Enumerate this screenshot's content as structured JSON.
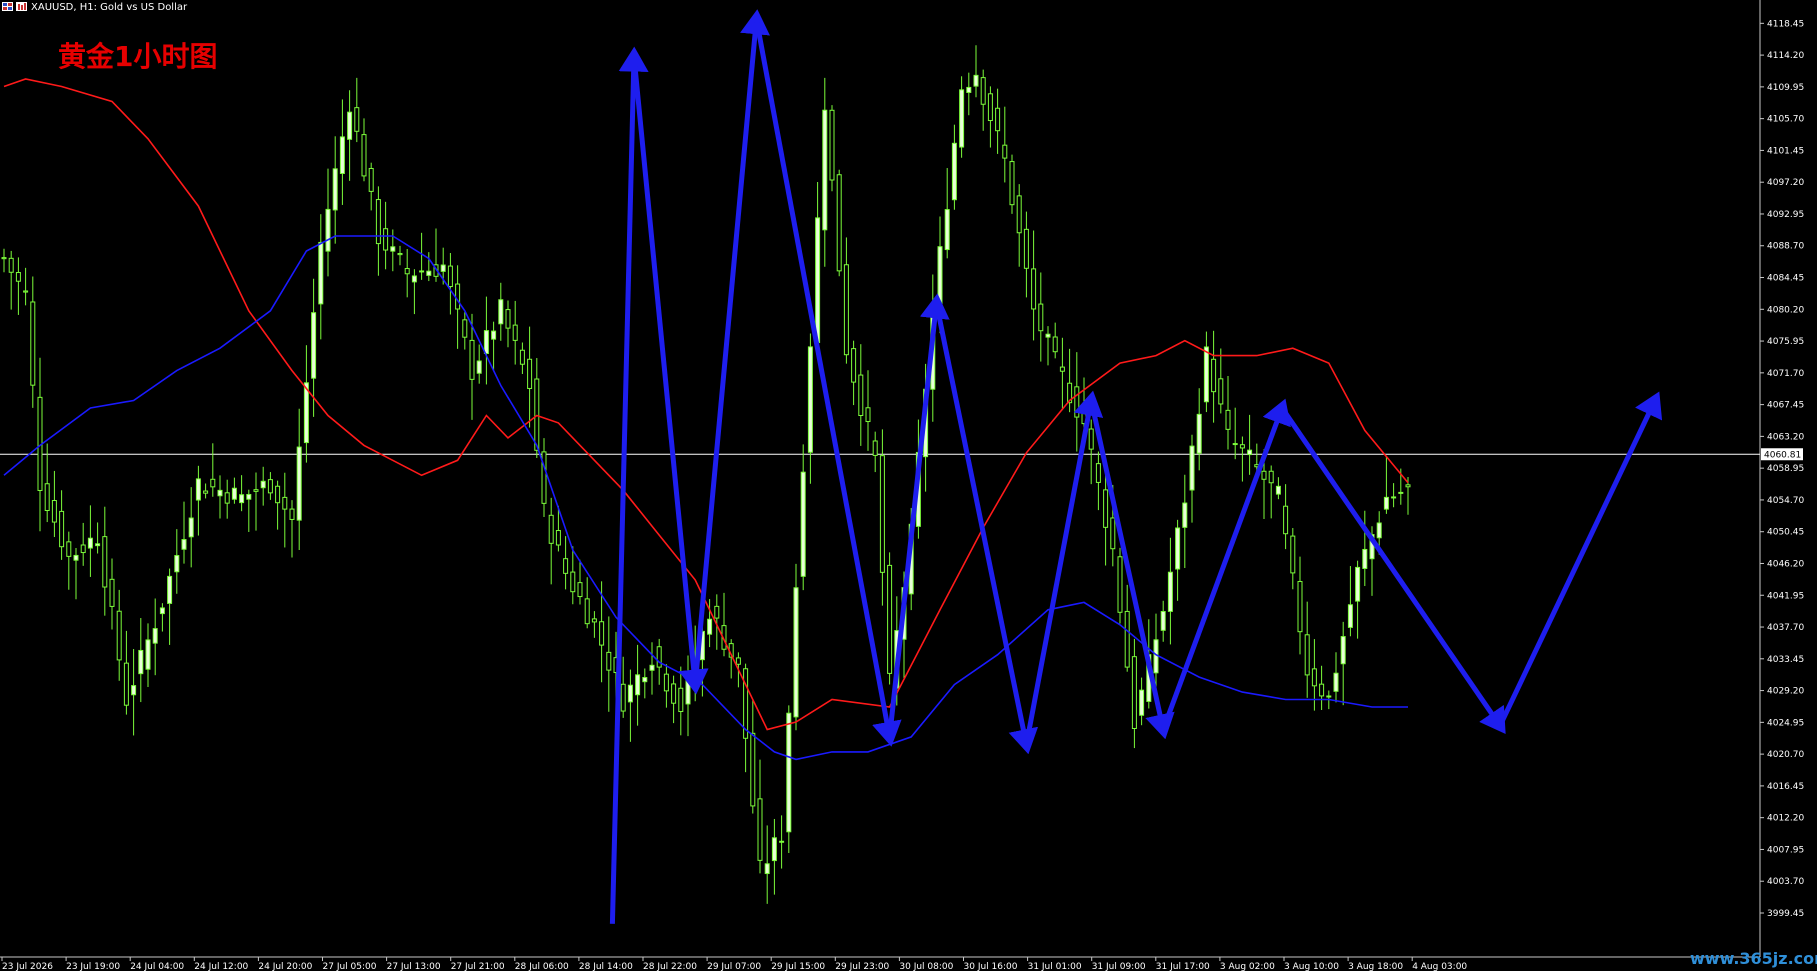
{
  "window": {
    "symbol_title": "XAUUSD, H1:  Gold vs US Dollar",
    "annotation_title": "黄金1小时图",
    "watermark": "www.365jz.com"
  },
  "colors": {
    "background": "#000000",
    "candle": "#7cfc3a",
    "candle_body": "#e8ffd8",
    "ma_fast": "#ff1a1a",
    "ma_slow": "#1a1aff",
    "arrows": "#1e1eee",
    "current_price_line": "#ffffff"
  },
  "icons": [
    "chart-window-icon",
    "chart-type-icon"
  ],
  "chart_data": {
    "type": "line",
    "ylim": [
      3994.5,
      4120.5
    ],
    "y_ticks": [
      "4118.45",
      "4114.20",
      "4109.95",
      "4105.70",
      "4101.45",
      "4097.20",
      "4092.95",
      "4088.70",
      "4084.45",
      "4080.20",
      "4075.95",
      "4071.70",
      "4067.45",
      "4063.20",
      "4058.95",
      "4054.70",
      "4050.45",
      "4046.20",
      "4041.95",
      "4037.70",
      "4033.45",
      "4029.20",
      "4024.95",
      "4020.70",
      "4016.45",
      "4012.20",
      "4007.95",
      "4003.70",
      "3999.45"
    ],
    "y_tick_values": [
      4118.45,
      4114.2,
      4109.95,
      4105.7,
      4101.45,
      4097.2,
      4092.95,
      4088.7,
      4084.45,
      4080.2,
      4075.95,
      4071.7,
      4067.45,
      4063.2,
      4058.95,
      4054.7,
      4050.45,
      4046.2,
      4041.95,
      4037.7,
      4033.45,
      4029.2,
      4024.95,
      4020.7,
      4016.45,
      4012.2,
      4007.95,
      4003.7,
      3999.45
    ],
    "x_ticks": [
      "23 Jul 2026",
      "23 Jul 19:00",
      "24 Jul 04:00",
      "24 Jul 12:00",
      "24 Jul 20:00",
      "27 Jul 05:00",
      "27 Jul 13:00",
      "27 Jul 21:00",
      "28 Jul 06:00",
      "28 Jul 14:00",
      "28 Jul 22:00",
      "29 Jul 07:00",
      "29 Jul 15:00",
      "29 Jul 23:00",
      "30 Jul 08:00",
      "30 Jul 16:00",
      "31 Jul 01:00",
      "31 Jul 09:00",
      "31 Jul 17:00",
      "3 Aug 02:00",
      "3 Aug 10:00",
      "3 Aug 18:00",
      "4 Aug 03:00"
    ],
    "current_price": 4060.81,
    "current_price_label": "4060.81",
    "anchors": [
      [
        0,
        4087
      ],
      [
        3,
        4082
      ],
      [
        5,
        4057
      ],
      [
        9,
        4047
      ],
      [
        13,
        4050
      ],
      [
        17,
        4028
      ],
      [
        22,
        4041
      ],
      [
        27,
        4057
      ],
      [
        33,
        4055
      ],
      [
        37,
        4057
      ],
      [
        40,
        4052
      ],
      [
        44,
        4089
      ],
      [
        48,
        4108
      ],
      [
        52,
        4090
      ],
      [
        56,
        4085
      ],
      [
        61,
        4086
      ],
      [
        65,
        4072
      ],
      [
        69,
        4080
      ],
      [
        73,
        4070
      ],
      [
        75,
        4053
      ],
      [
        78,
        4045
      ],
      [
        82,
        4038
      ],
      [
        86,
        4028
      ],
      [
        90,
        4034
      ],
      [
        94,
        4027
      ],
      [
        98,
        4040
      ],
      [
        102,
        4032
      ],
      [
        105,
        4005
      ],
      [
        108,
        4010
      ],
      [
        111,
        4060
      ],
      [
        114,
        4108
      ],
      [
        117,
        4075
      ],
      [
        121,
        4060
      ],
      [
        123,
        4030
      ],
      [
        126,
        4050
      ],
      [
        129,
        4080
      ],
      [
        133,
        4110
      ],
      [
        135,
        4112
      ],
      [
        139,
        4100
      ],
      [
        143,
        4080
      ],
      [
        146,
        4073
      ],
      [
        150,
        4065
      ],
      [
        154,
        4048
      ],
      [
        157,
        4025
      ],
      [
        161,
        4040
      ],
      [
        164,
        4055
      ],
      [
        167,
        4074
      ],
      [
        170,
        4063
      ],
      [
        173,
        4060
      ],
      [
        177,
        4055
      ],
      [
        181,
        4032
      ],
      [
        184,
        4028
      ],
      [
        188,
        4045
      ],
      [
        192,
        4055
      ],
      [
        195,
        4056
      ]
    ],
    "ma_fast": [
      [
        0,
        4110
      ],
      [
        3,
        4111
      ],
      [
        8,
        4110
      ],
      [
        15,
        4108
      ],
      [
        20,
        4103
      ],
      [
        27,
        4094
      ],
      [
        34,
        4080
      ],
      [
        40,
        4072
      ],
      [
        45,
        4066
      ],
      [
        50,
        4062
      ],
      [
        58,
        4058
      ],
      [
        63,
        4060
      ],
      [
        67,
        4066
      ],
      [
        70,
        4063
      ],
      [
        74,
        4066
      ],
      [
        77,
        4065
      ],
      [
        82,
        4060
      ],
      [
        86,
        4056
      ],
      [
        91,
        4050
      ],
      [
        96,
        4044
      ],
      [
        101,
        4034
      ],
      [
        106,
        4024
      ],
      [
        110,
        4025
      ],
      [
        115,
        4028
      ],
      [
        123,
        4027
      ],
      [
        130,
        4040
      ],
      [
        136,
        4051
      ],
      [
        142,
        4061
      ],
      [
        148,
        4068
      ],
      [
        155,
        4073
      ],
      [
        160,
        4074
      ],
      [
        164,
        4076
      ],
      [
        168,
        4074
      ],
      [
        174,
        4074
      ],
      [
        179,
        4075
      ],
      [
        184,
        4073
      ],
      [
        189,
        4064
      ],
      [
        195,
        4057
      ]
    ],
    "ma_slow": [
      [
        0,
        4058
      ],
      [
        5,
        4062
      ],
      [
        12,
        4067
      ],
      [
        18,
        4068
      ],
      [
        24,
        4072
      ],
      [
        30,
        4075
      ],
      [
        37,
        4080
      ],
      [
        42,
        4088
      ],
      [
        46,
        4090
      ],
      [
        50,
        4090
      ],
      [
        54,
        4090
      ],
      [
        59,
        4087
      ],
      [
        64,
        4080
      ],
      [
        69,
        4070
      ],
      [
        74,
        4062
      ],
      [
        79,
        4048
      ],
      [
        85,
        4039
      ],
      [
        91,
        4033
      ],
      [
        97,
        4030
      ],
      [
        103,
        4024
      ],
      [
        107,
        4021
      ],
      [
        110,
        4020
      ],
      [
        115,
        4021
      ],
      [
        120,
        4021
      ],
      [
        126,
        4023
      ],
      [
        132,
        4030
      ],
      [
        138,
        4034
      ],
      [
        145,
        4040
      ],
      [
        150,
        4041
      ],
      [
        155,
        4038
      ],
      [
        160,
        4034
      ],
      [
        166,
        4031
      ],
      [
        172,
        4029
      ],
      [
        178,
        4028
      ],
      [
        184,
        4028
      ],
      [
        190,
        4027
      ],
      [
        195,
        4027
      ]
    ],
    "zigzag": [
      [
        84.5,
        3998
      ],
      [
        87.5,
        4114
      ],
      [
        96,
        4030
      ],
      [
        104.5,
        4119
      ],
      [
        123,
        4023
      ],
      [
        129.5,
        4081
      ],
      [
        142,
        4022
      ],
      [
        151,
        4068
      ],
      [
        161,
        4024
      ],
      [
        177.5,
        4067
      ]
    ],
    "bar_count": 196,
    "grid": false,
    "legend": "none"
  }
}
